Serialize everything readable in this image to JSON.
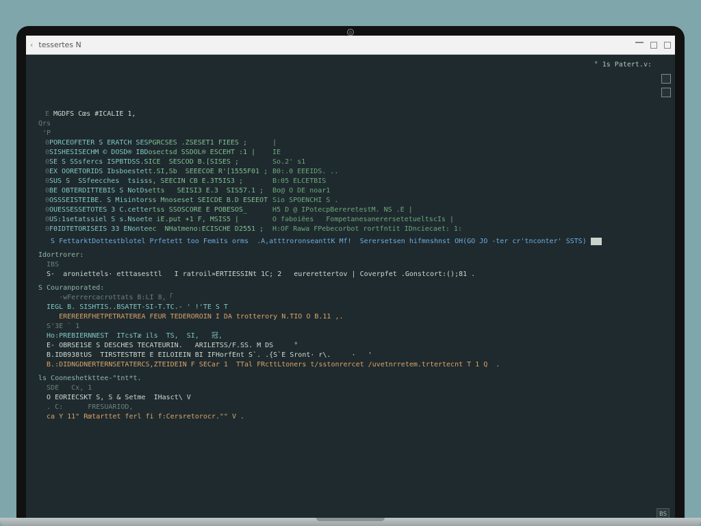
{
  "window": {
    "title": "tessertes N",
    "top_right": "° 1s Patert.v:"
  },
  "badge": "BS",
  "header_line": "MGDFS Cœs #ICALIE 1,",
  "table": [
    {
      "a": "0",
      "b": "PORCEOFETER S ERATCH SESPGRCSES .ZSESET1 FIEES ;",
      "c": "|"
    },
    {
      "a": "0",
      "b": "SISHESISECHM © DOSD® IBDosectsd SSDOL® ESCEHT :1 |",
      "c": "IE"
    },
    {
      "a": "0",
      "b": "SE S SSsfercs ISPBTDSS.SICE  SESCOD B.[SISES ;",
      "c": "So.2' s1"
    },
    {
      "a": "0",
      "b": "EX OORETORIDS Ibsboestett.SI,Sb  SEEECOE R'[1555F01 ;",
      "c": "B0:.0 EEEIDS. .."
    },
    {
      "a": "0",
      "b": "SUS S  SSfeecches  tsisss, SEECIN CB E.3T5IS3 ;",
      "c": "B:05 ELCETBIS"
    },
    {
      "a": "0",
      "b": "BE OBTERDITTEBIS S NotDsetts   SEISI3 E.3  SIS57.1 ;",
      "c": "Bo@ O DE noar1"
    },
    {
      "a": "0",
      "b": "OSSSEISTEIBE. S Misintorss Mnoseset SEICDE B.D ESEEOT|",
      "c": "Sio SPOENCHI S ."
    },
    {
      "a": "0",
      "b": "OUESSESSETOTES 3 C.cettertss SSOSCORE E POBESOS_",
      "c": "H5 D @ IPotecpBereretestM. NS .E |"
    },
    {
      "a": "0",
      "b": "US:1setatssiel S s.Nsoete iE.put +1 F, MSIS5 |",
      "c": "O fǝboiëes   FompetanesanerersetetueltscIs |"
    },
    {
      "a": "0",
      "b": "F0IDTETORISEIS 33 ENonteec  NHatmeno:ECISCHE D2551 ;",
      "c": "H:OF Rawa FPebecorbot rortfntit IDnciecaet: 1:"
    }
  ],
  "status_line": {
    "pre": "S FettarktDottestblotel Prfetett too Femits orms  .A,atttroronseanttK Mf!  Serersetsen hifmnshnst OH(GO JO -ter cr'tnconter' SSTS) ",
    "flag": "■"
  },
  "sections": [
    {
      "head": "Idortrorer:",
      "lines": [
        {
          "txt": "  IBS",
          "cls": "dm"
        },
        {
          "txt": "  S·  aroniettels· etttasesttl   I ratroil»ERTIESSINt 1C; 2   eurerettertov | Coverpfet .Gonstcort:();81 .",
          "cls": ""
        }
      ]
    },
    {
      "head": "S Couranporated:",
      "lines": [
        {
          "txt": "     ·wFerrercacrottats B:LI 8,「",
          "cls": "dm"
        },
        {
          "txt": "  IEGL B. SISHTIS..BSATET-SI-T.TC.- ' !'TE S T",
          "cls": "cy"
        },
        {
          "txt": "     EREREERFHETPETRATEREA FEUR TEDEROROIN I DA trotterory N.TIO O B.11 ,.",
          "cls": "or"
        },
        {
          "txt": "  S'3E ` 1",
          "cls": "dm"
        },
        {
          "txt": "  Ho:PREBIERNNEST  ITcsTæ ils  TS,  SI,   冠,",
          "cls": "cy"
        },
        {
          "txt": "  E- OBRSE1SE S DESCHES TECATEURIN.   ARILETSS/F.SS. M DS     °",
          "cls": "wh"
        },
        {
          "txt": "  B.IDB938tUS  TIRSTESTBTE E EILOIEIN BI IFHorfEnt S`. .{S`E Sront· r\\.     ·   '",
          "cls": ""
        },
        {
          "txt": "  B.:DIDNGDNERTERNSETATERCS,ZTEIDEIN F SECar 1  TTal FRcttLtoners t/sstonrercet /uvetnrretem.trtertecnt T 1 Q  .",
          "cls": "or"
        }
      ]
    },
    {
      "head": "ls Cooneshetkttee-\"tnt*t.",
      "lines": [
        {
          "txt": "  SDE   Cx, 1",
          "cls": "dm"
        },
        {
          "txt": "  O EORIECSKT S, S & Setme  IHasct\\ V",
          ",cls": ""
        },
        {
          "txt": "  . C:      FRESUARIOD,",
          "cls": "dm"
        },
        {
          "txt": "  ca Y 11\" Rœtarttet ferl fi f:Cersretorocr.\"\" V .",
          "cls": "or"
        }
      ]
    }
  ]
}
